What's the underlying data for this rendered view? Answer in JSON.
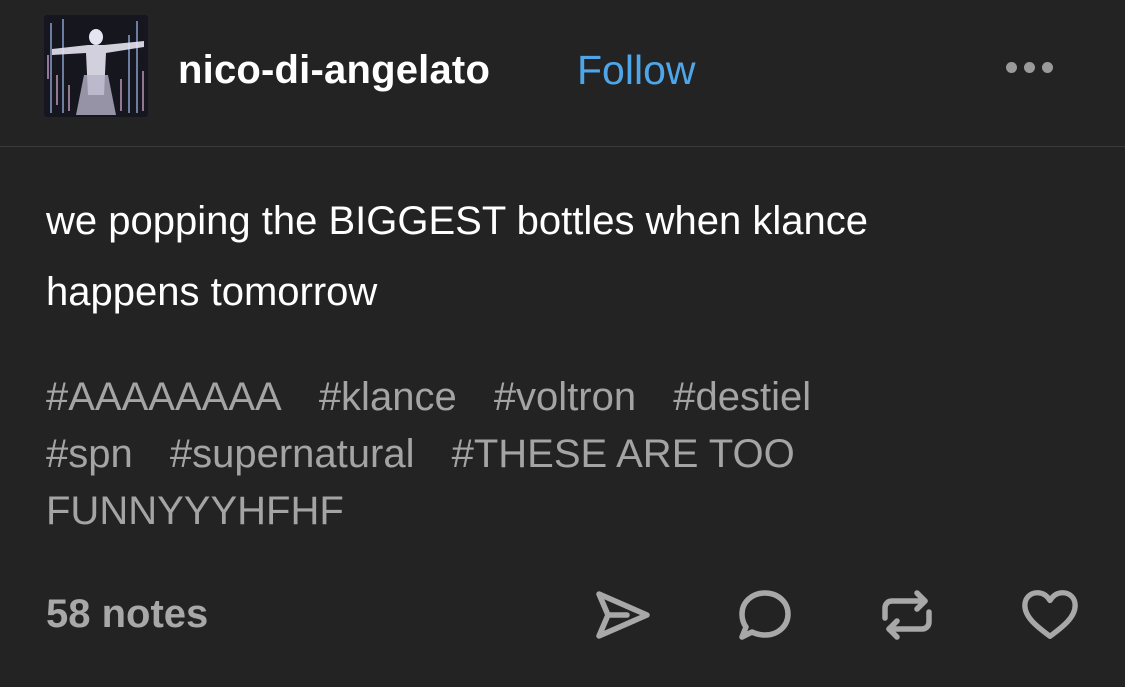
{
  "post": {
    "username": "nico-di-angelato",
    "follow_label": "Follow",
    "more_icon": "more-horizontal-icon",
    "body_lines": [
      "we popping the BIGGEST bottles when klance",
      "happens tomorrow"
    ],
    "tags": [
      "#AAAAAAAA",
      "#klance",
      "#voltron",
      "#destiel",
      "#spn",
      "#supernatural",
      "#THESE ARE TOO FUNNYYYHFHF"
    ],
    "notes_label": "58 notes"
  },
  "actions": {
    "share_icon": "share-send-icon",
    "reply_icon": "reply-bubble-icon",
    "reblog_icon": "reblog-icon",
    "like_icon": "heart-icon"
  },
  "colors": {
    "background": "#232323",
    "follow_blue": "#4ea5e7",
    "tag_gray": "#a4a4a4",
    "icon_gray": "#a8a8a8"
  }
}
